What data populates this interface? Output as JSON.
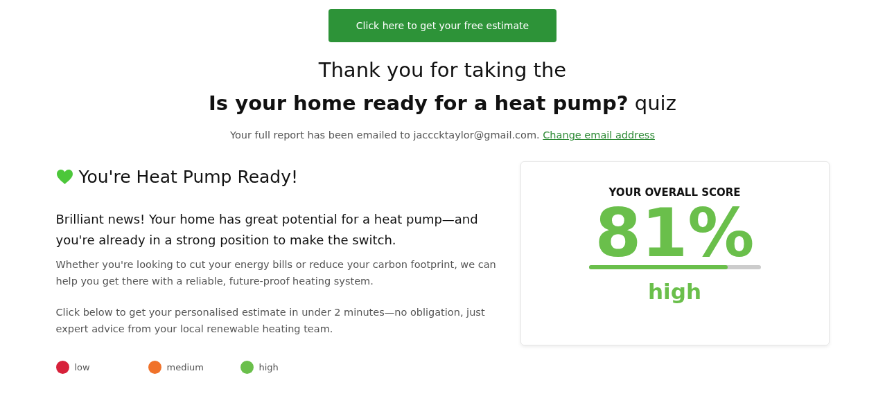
{
  "cta_button": {
    "label": "Click here to get your free estimate"
  },
  "heading": {
    "line_1": "Thank you for taking the",
    "line_2": "**Is your home ready for a heat pump?** quiz"
  },
  "email_notice": {
    "text": "Your full report has been emailed to jacccktaylor@gmail.com.",
    "link": "Change email address"
  },
  "result": {
    "title": "You're Heat Pump Ready!",
    "lead": "Brilliant news! Your home has great potential for a heat pump—and you're already in a strong position to make the switch.",
    "paragraphs": [
      "Whether you're looking to cut your energy bills or reduce your carbon footprint, we can help you get there with a reliable, future-proof heating system.",
      "Click below to get your personalised estimate in under 2 minutes—no obligation, just expert advice from your local renewable heating team."
    ]
  },
  "legend": [
    {
      "label": "low",
      "color": "#d7213a"
    },
    {
      "label": "medium",
      "color": "#f0722a"
    },
    {
      "label": "high",
      "color": "#6abf4b"
    }
  ],
  "score_card": {
    "heading": "YOUR OVERALL SCORE",
    "value": "81%",
    "level": 0.81,
    "rating": "high",
    "color": "#6abf4b"
  }
}
